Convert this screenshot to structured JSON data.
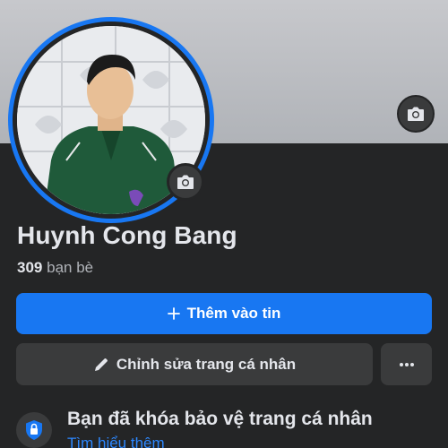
{
  "profile": {
    "name": "Huynh Cong Bang",
    "friends_count": "309",
    "friends_label": "bạn bè"
  },
  "actions": {
    "add_story_icon": "plus-icon",
    "add_story_label": "Thêm vào tin",
    "edit_profile_icon": "pencil-icon",
    "edit_profile_label": "Chỉnh sửa trang cá nhân",
    "more_icon": "more-dots-icon"
  },
  "lock_notice": {
    "icon": "shield-lock-icon",
    "title": "Bạn đã khóa bảo vệ trang cá nhân",
    "link": "Tìm hiểu thêm"
  },
  "colors": {
    "background": "#242526",
    "primary": "#1877f2",
    "secondary": "#3a3b3c",
    "link": "#2d88ff"
  }
}
